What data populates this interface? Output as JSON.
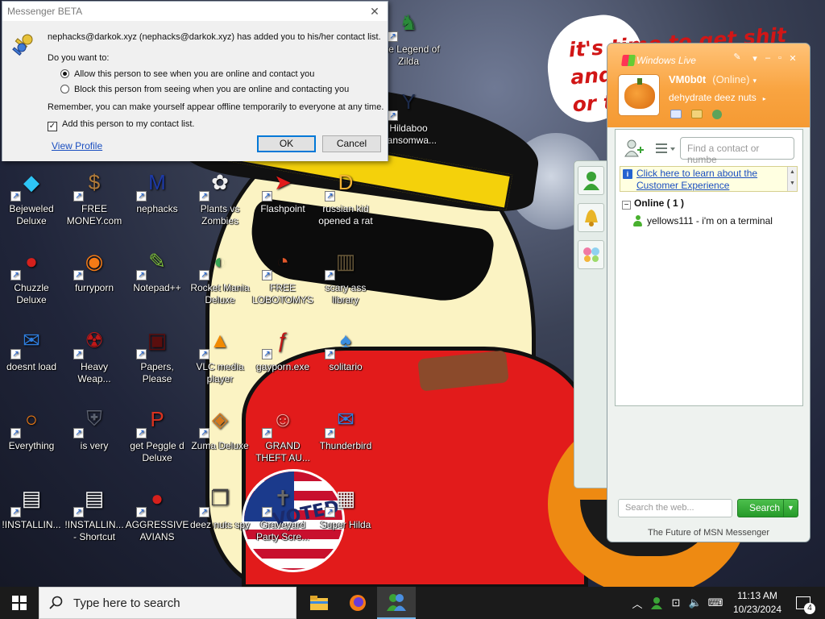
{
  "dialog": {
    "title": "Messenger BETA",
    "message": "nephacks@darkok.xyz (nephacks@darkok.xyz) has added you to his/her contact list.",
    "question": "Do you want to:",
    "option_allow": "Allow this person to see when you are online and contact you",
    "option_block": "Block this person from seeing when you are online and contacting you",
    "remember": "Remember, you can make yourself appear offline temporarily to everyone at any time.",
    "add_contact": "Add this person to my contact list.",
    "view_profile": "View Profile",
    "ok": "OK",
    "cancel": "Cancel"
  },
  "background": {
    "slogan_line1": "it's time to get shit",
    "slogan_line2": "and",
    "slogan_line3": "or t",
    "sticker_text": "VOTED"
  },
  "desktop_icons": [
    {
      "label": "Bejeweled Deluxe",
      "icon": "gem-icon",
      "color": "#2ec5f5"
    },
    {
      "label": "FREE MONEY.com",
      "icon": "money-bag-icon",
      "color": "#b07a3a"
    },
    {
      "label": "nephacks",
      "icon": "mpi-logo-icon",
      "color": "#1d3aa8"
    },
    {
      "label": "Plants vs Zombies",
      "icon": "flower-icon",
      "color": "#f0f0f0"
    },
    {
      "label": "Flashpoint",
      "icon": "flashpoint-icon",
      "color": "#e11b1b"
    },
    {
      "label": "russian kid opened a rat",
      "icon": "de-logo-icon",
      "color": "#f2b233"
    },
    {
      "label": "Chuzzle Deluxe",
      "icon": "chuzzle-icon",
      "color": "#d5201c"
    },
    {
      "label": "furryporn",
      "icon": "firefox-icon",
      "color": "#f57b16"
    },
    {
      "label": "Notepad++",
      "icon": "notepad-icon",
      "color": "#7cbc3b"
    },
    {
      "label": "Rocket Mania Deluxe",
      "icon": "rocket-icon",
      "color": "#3aa655"
    },
    {
      "label": "FREE LOBOTOMYS",
      "icon": "clock-icon",
      "color": "#e2572a"
    },
    {
      "label": "scary ass library",
      "icon": "library-icon",
      "color": "#6a5a3a"
    },
    {
      "label": "doesnt load",
      "icon": "thunderbird-icon",
      "color": "#2f7fe0"
    },
    {
      "label": "Heavy Weap...",
      "icon": "radiation-icon",
      "color": "#c01818"
    },
    {
      "label": "Papers, Please",
      "icon": "papers-icon",
      "color": "#5a0e0e"
    },
    {
      "label": "VLC media player",
      "icon": "vlc-cone-icon",
      "color": "#f18a00"
    },
    {
      "label": "gayporn.exe",
      "icon": "flash-player-icon",
      "color": "#c41616"
    },
    {
      "label": "solitario",
      "icon": "solitaire-icon",
      "color": "#3b8ee0"
    },
    {
      "label": "Everything",
      "icon": "search-ring-icon",
      "color": "#f07b12"
    },
    {
      "label": "is very",
      "icon": "shield-icon",
      "color": "#5c6270"
    },
    {
      "label": "get Peggle d Deluxe",
      "icon": "peggle-icon",
      "color": "#d9321f"
    },
    {
      "label": "Zuma Deluxe",
      "icon": "zuma-icon",
      "color": "#d6791c"
    },
    {
      "label": "GRAND THEFT AU...",
      "icon": "anime-girl-icon",
      "color": "#f7a8a0"
    },
    {
      "label": "Thunderbird",
      "icon": "thunderbird-icon",
      "color": "#2f7fe0"
    },
    {
      "label": "!INSTALLIN...",
      "icon": "document-icon",
      "color": "#f4f4f4"
    },
    {
      "label": "!INSTALLIN... - Shortcut",
      "icon": "document-icon",
      "color": "#f4f4f4"
    },
    {
      "label": "AGGRESSIVE AVIANS",
      "icon": "angry-bird-icon",
      "color": "#d6201c"
    },
    {
      "label": "deez nuts spy",
      "icon": "windows-stack-icon",
      "color": "#444"
    },
    {
      "label": "Graveyard Party Scre...",
      "icon": "graveyard-icon",
      "color": "#6a6a6a"
    },
    {
      "label": "Super Hilda",
      "icon": "pixel-dog-icon",
      "color": "#f2f2f2"
    },
    {
      "label": "The Legend of Zilda",
      "icon": "zilda-icon",
      "color": "#2a8a3a"
    },
    {
      "label": "Hildaboo Ransomwa...",
      "icon": "yashma-icon",
      "color": "#1c2a4a"
    }
  ],
  "msn": {
    "brand": "Windows Live",
    "username": "VM0b0t",
    "status": "(Online)",
    "personal_message": "dehydrate deez nuts",
    "find_placeholder": "Find a contact or numbe",
    "promo_text": "Click here to learn about the Customer Experience",
    "group_label": "Online ( 1 )",
    "contacts": [
      {
        "name": "yellows111 - i'm on a terminal"
      }
    ],
    "web_search_placeholder": "Search the web...",
    "search_button": "Search",
    "footer": "The Future of MSN Messenger"
  },
  "taskbar": {
    "search_placeholder": "Type here to search",
    "time": "11:13 AM",
    "date": "10/23/2024",
    "notification_count": "4"
  }
}
